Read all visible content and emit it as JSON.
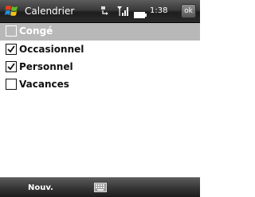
{
  "titlebar": {
    "title": "Calendrier",
    "time": "1:38",
    "ok_label": "ok",
    "icons": [
      "windows-start-icon",
      "sync-icon",
      "signal-icon",
      "battery-icon"
    ]
  },
  "list": {
    "items": [
      {
        "label": "Congé",
        "checked": false,
        "selected": true
      },
      {
        "label": "Occasionnel",
        "checked": true,
        "selected": false
      },
      {
        "label": "Personnel",
        "checked": true,
        "selected": false
      },
      {
        "label": "Vacances",
        "checked": false,
        "selected": false
      }
    ]
  },
  "bottombar": {
    "left_softkey": "Nouv.",
    "center_icon": "keyboard-icon"
  },
  "colors": {
    "selection": "#b8b8b8",
    "bar_dark": "#2a2a2a",
    "text": "#111111"
  }
}
